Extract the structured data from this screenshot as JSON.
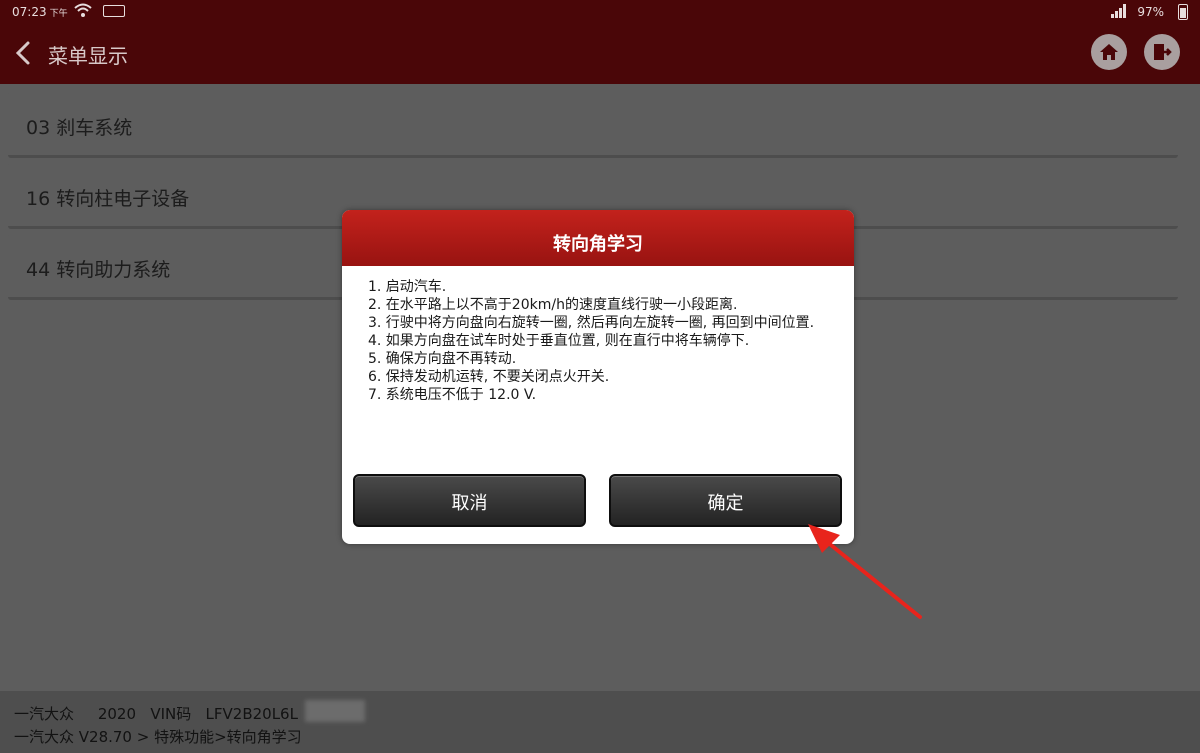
{
  "status_bar": {
    "time": "07:23",
    "ampm": "下午",
    "battery_percent": "97%"
  },
  "header": {
    "title": "菜单显示"
  },
  "menu_items": [
    {
      "label": "03 刹车系统"
    },
    {
      "label": "16 转向柱电子设备"
    },
    {
      "label": "44 转向助力系统"
    }
  ],
  "dialog": {
    "title": "转向角学习",
    "lines": [
      "1. 启动汽车.",
      "2. 在水平路上以不高于20km/h的速度直线行驶一小段距离.",
      "3. 行驶中将方向盘向右旋转一圈, 然后再向左旋转一圈, 再回到中间位置.",
      "4. 如果方向盘在试车时处于垂直位置, 则在直行中将车辆停下.",
      "5. 确保方向盘不再转动.",
      "6. 保持发动机运转, 不要关闭点火开关.",
      "7. 系统电压不低于 12.0 V."
    ],
    "cancel_label": "取消",
    "confirm_label": "确定"
  },
  "footer": {
    "line1": "一汽大众     2020   VIN码   LFV2B20L6L",
    "line2": "一汽大众 V28.70 > 特殊功能>转向角学习"
  },
  "colors": {
    "header_bg": "#4a0608",
    "dialog_header": "#b51c17",
    "annotation_arrow": "#e8241c"
  }
}
